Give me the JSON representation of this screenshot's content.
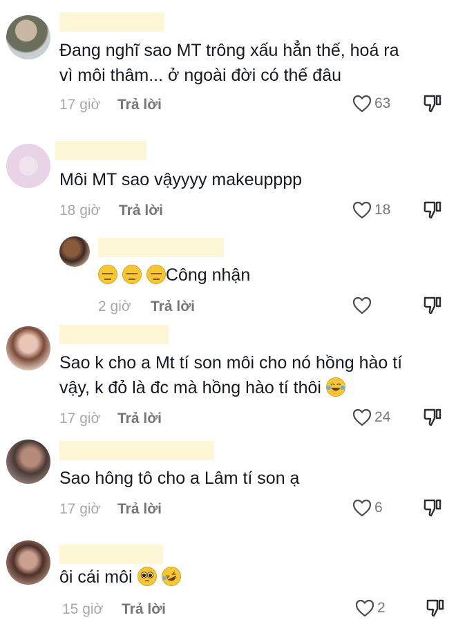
{
  "comments": [
    {
      "text_lines": [
        "Đang nghĩ sao MT trông xấu hẳn thế, hoá ra",
        "vì môi thâm... ở ngoài đời có thế đâu"
      ],
      "time": "17 giờ",
      "reply_label": "Trả lời",
      "likes": "63"
    },
    {
      "text_lines": [
        "Môi MT sao vậyyyy makeupppp"
      ],
      "time": "18 giờ",
      "reply_label": "Trả lời",
      "likes": "18"
    },
    {
      "text_lines": [
        "Công nhận"
      ],
      "emoji_prefix": [
        "expressionless-face",
        "expressionless-face",
        "expressionless-face"
      ],
      "time": "2 giờ",
      "reply_label": "Trả lời",
      "likes": ""
    },
    {
      "text_lines": [
        "Sao k cho a Mt tí son môi cho nó hồng hào tí",
        "vậy, k đỏ là đc mà hồng hào tí thôi"
      ],
      "emoji_suffix": [
        "tears-of-joy-face"
      ],
      "time": "17 giờ",
      "reply_label": "Trả lời",
      "likes": "24"
    },
    {
      "text_lines": [
        "Sao hông tô cho a Lâm tí son ạ"
      ],
      "time": "17 giờ",
      "reply_label": "Trả lời",
      "likes": "6"
    },
    {
      "text_lines": [
        "ôi cái môi"
      ],
      "emoji_suffix": [
        "pleading-face",
        "rolling-laughing-face"
      ],
      "time": "15 giờ",
      "reply_label": "Trả lời",
      "likes": "2"
    }
  ],
  "colors": {
    "text": "#161823",
    "meta": "#a7a8ad",
    "name_redaction": "#fdf7d6"
  }
}
